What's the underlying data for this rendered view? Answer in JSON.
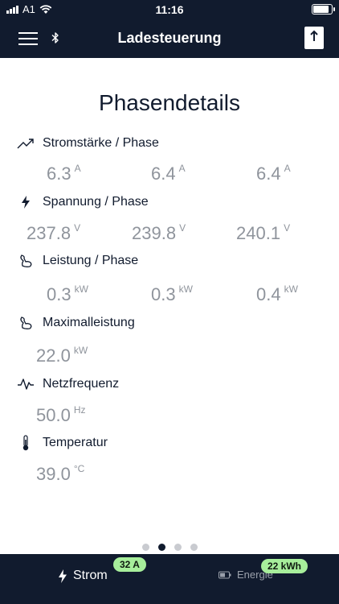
{
  "status_bar": {
    "carrier": "A1",
    "time": "11:16"
  },
  "header": {
    "title": "Ladesteuerung"
  },
  "main": {
    "title": "Phasendetails",
    "sections": {
      "current": {
        "label": "Stromstärke / Phase",
        "values": [
          {
            "v": "6.3",
            "u": "A"
          },
          {
            "v": "6.4",
            "u": "A"
          },
          {
            "v": "6.4",
            "u": "A"
          }
        ]
      },
      "voltage": {
        "label": "Spannung / Phase",
        "values": [
          {
            "v": "237.8",
            "u": "V"
          },
          {
            "v": "239.8",
            "u": "V"
          },
          {
            "v": "240.1",
            "u": "V"
          }
        ]
      },
      "power": {
        "label": "Leistung / Phase",
        "values": [
          {
            "v": "0.3",
            "u": "kW"
          },
          {
            "v": "0.3",
            "u": "kW"
          },
          {
            "v": "0.4",
            "u": "kW"
          }
        ]
      },
      "max_power": {
        "label": "Maximalleistung",
        "value": {
          "v": "22.0",
          "u": "kW"
        }
      },
      "frequency": {
        "label": "Netzfrequenz",
        "value": {
          "v": "50.0",
          "u": "Hz"
        }
      },
      "temperature": {
        "label": "Temperatur",
        "value": {
          "v": "39.0",
          "u": "°C"
        }
      }
    },
    "page_indicator": {
      "count": 4,
      "active": 2
    }
  },
  "tab_bar": {
    "strom": {
      "label": "Strom",
      "badge": "32 A"
    },
    "energie": {
      "label": "Energie",
      "badge": "22 kWh"
    }
  },
  "colors": {
    "nav_bg": "#111b2e",
    "badge_bg": "#a7ee9b",
    "value_text": "#8f949c"
  }
}
